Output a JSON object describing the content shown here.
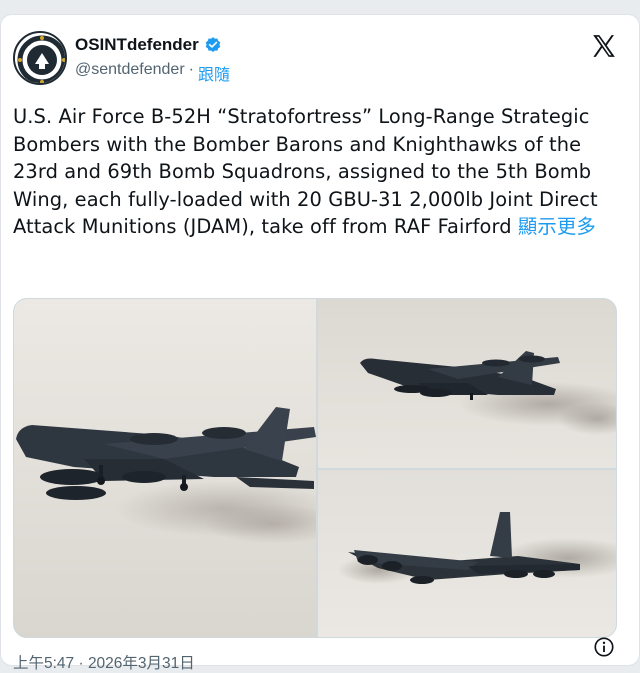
{
  "account": {
    "display_name": "OSINTdefender",
    "handle": "@sentdefender",
    "separator": "·",
    "follow_label": "跟隨",
    "verified_icon": "verified-badge-icon",
    "verified_color": "#1d9bf0"
  },
  "platform_logo": "x-logo-icon",
  "tweet": {
    "text": "U.S. Air Force B-52H “Stratofortress” Long-Range Strategic Bombers with the Bomber Barons and Knighthawks of the 23rd and 69th Bomb Squadrons, assigned to the 5th Bomb Wing, each fully-loaded with 20 GBU-31 2,000lb Joint Direct Attack Munitions (JDAM), take off from RAF Fairford",
    "show_more_label": "顯示更多"
  },
  "media": {
    "photos": [
      "b52-photo-1",
      "b52-photo-2",
      "b52-photo-3"
    ]
  },
  "footer": {
    "timestamp": "上午5:47 · 2026年3月31日",
    "info_icon": "info-icon"
  },
  "colors": {
    "link": "#1d9bf0",
    "muted": "#536471",
    "text": "#0f1419"
  }
}
